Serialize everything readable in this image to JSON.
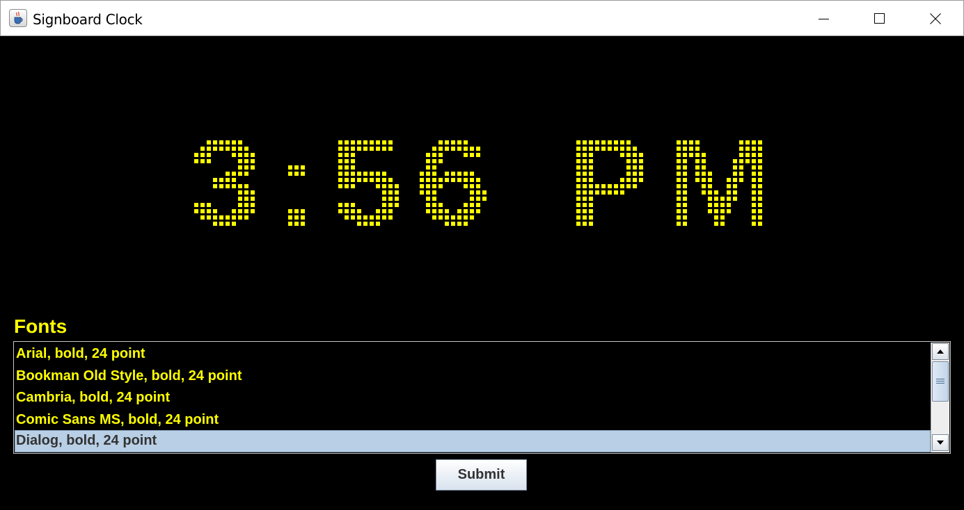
{
  "window": {
    "title": "Signboard Clock",
    "app_icon": "java-cup-icon",
    "controls": [
      "minimize-icon",
      "maximize-icon",
      "close-icon"
    ]
  },
  "clock": {
    "time_text": "3:56 PM",
    "led_color": "#ffff00",
    "background_color": "#000000"
  },
  "fonts_panel": {
    "label": "Fonts",
    "items": [
      {
        "label": "Arial, bold, 24 point"
      },
      {
        "label": "Bookman Old Style, bold, 24 point"
      },
      {
        "label": "Cambria, bold, 24 point"
      },
      {
        "label": "Comic Sans MS, bold, 24 point"
      },
      {
        "label": "Dialog, bold, 24 point",
        "selected": true
      }
    ],
    "selection_color": "#b8cfe5"
  },
  "submit_label": "Submit"
}
